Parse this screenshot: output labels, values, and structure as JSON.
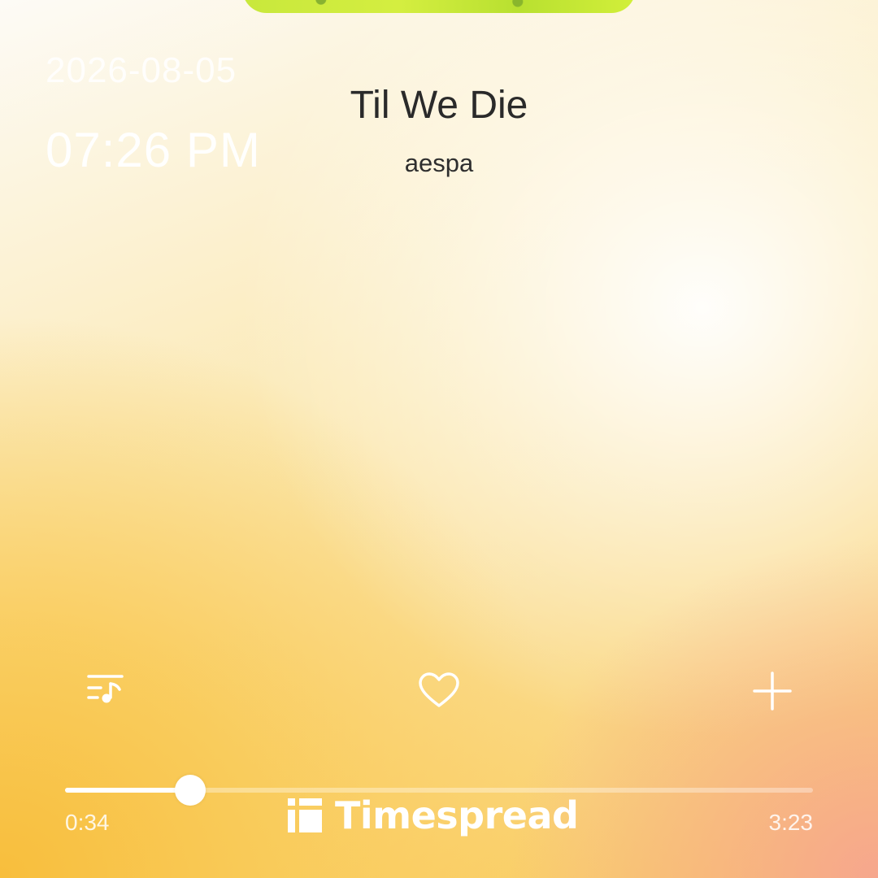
{
  "status": {
    "date": "2026-08-05",
    "time": "07:26 PM"
  },
  "track": {
    "title": "Til We Die",
    "artist": "aespa"
  },
  "controls": {
    "playlist_icon": "playlist-music-icon",
    "favorite_icon": "heart-outline-icon",
    "add_icon": "plus-icon"
  },
  "progress": {
    "elapsed": "0:34",
    "total": "3:23",
    "fraction": 0.1675
  },
  "watermark": {
    "text": "Timespread"
  },
  "colors": {
    "accent": "#ffffff",
    "title_text": "#2a2a2a",
    "bg_warm": "#f9cb5e",
    "bg_pink": "#f6a096"
  }
}
